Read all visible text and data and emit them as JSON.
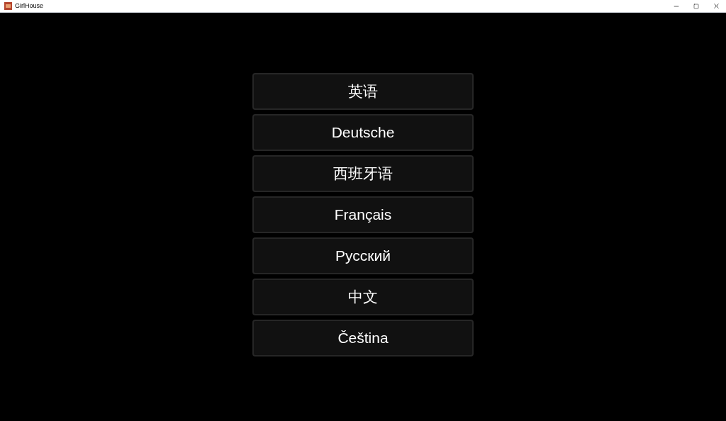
{
  "window": {
    "title": "GirlHouse"
  },
  "languages": [
    {
      "label": "英语"
    },
    {
      "label": "Deutsche"
    },
    {
      "label": "西班牙语"
    },
    {
      "label": "Français"
    },
    {
      "label": "Русский"
    },
    {
      "label": "中文"
    },
    {
      "label": "Čeština"
    }
  ]
}
